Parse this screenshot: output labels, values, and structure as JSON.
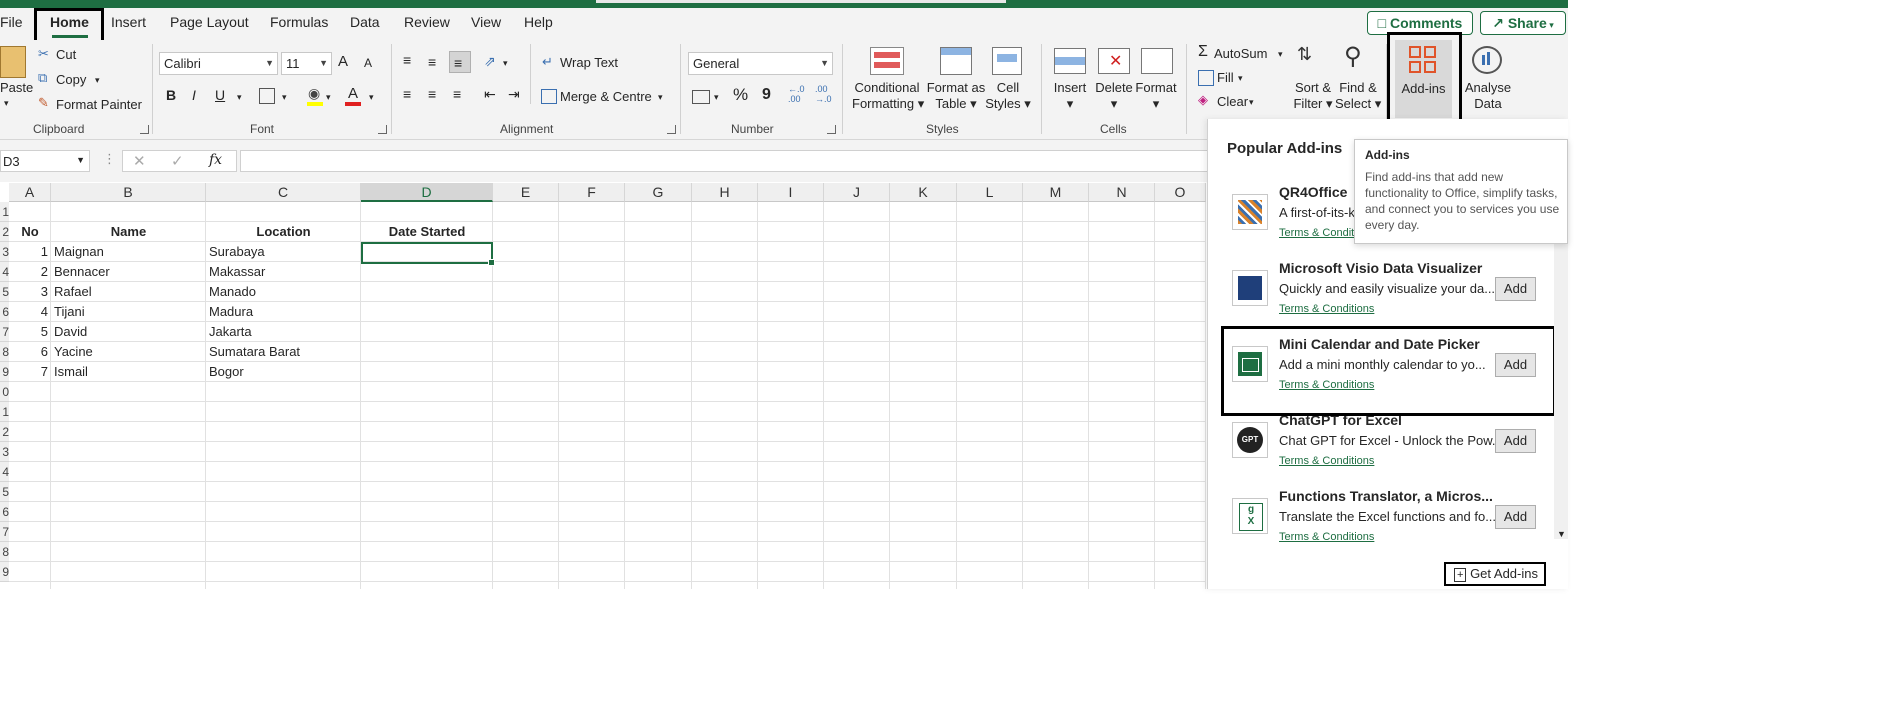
{
  "tabs": [
    "File",
    "Home",
    "Insert",
    "Page Layout",
    "Formulas",
    "Data",
    "Review",
    "View",
    "Help"
  ],
  "header": {
    "comments": "Comments",
    "share": "Share"
  },
  "clipboard": {
    "paste": "Paste",
    "cut": "Cut",
    "copy": "Copy",
    "format_painter": "Format Painter",
    "label": "Clipboard"
  },
  "font": {
    "name": "Calibri",
    "size": "11",
    "bold": "B",
    "italic": "I",
    "underline": "U",
    "color_letter": "A",
    "grow": "A",
    "shrink": "A",
    "label": "Font"
  },
  "alignment": {
    "wrap_text": "Wrap Text",
    "merge_centre": "Merge & Centre",
    "label": "Alignment"
  },
  "number": {
    "format": "General",
    "percent": "%",
    "comma": "9",
    "inc_dec1": ".0",
    "inc_dec2": ".00",
    "dec_dec1": ".00",
    "dec_dec2": ".0",
    "label": "Number"
  },
  "styles": {
    "conditional": [
      "Conditional",
      "Formatting"
    ],
    "format_table": [
      "Format as",
      "Table"
    ],
    "cell_styles": [
      "Cell",
      "Styles"
    ],
    "label": "Styles"
  },
  "cells": {
    "insert": "Insert",
    "delete": "Delete",
    "format": "Format",
    "label": "Cells"
  },
  "editing": {
    "autosum": "AutoSum",
    "fill": "Fill",
    "clear": "Clear",
    "sort_filter": [
      "Sort &",
      "Filter"
    ],
    "find_select": [
      "Find &",
      "Select"
    ]
  },
  "addins_btn": "Add-ins",
  "analyse_btn": [
    "Analyse",
    "Data"
  ],
  "formula_bar": {
    "name_box": "D3",
    "fx": "fx"
  },
  "sheet": {
    "columns": [
      "A",
      "B",
      "C",
      "D",
      "E",
      "F",
      "G",
      "H",
      "I",
      "J",
      "K",
      "L",
      "M",
      "N",
      "O"
    ],
    "row_numbers": [
      "1",
      "2",
      "3",
      "4",
      "5",
      "6",
      "7",
      "8",
      "9",
      "0",
      "1",
      "2",
      "3",
      "4",
      "5",
      "6",
      "7",
      "8",
      "9"
    ],
    "header": {
      "no": "No",
      "name": "Name",
      "location": "Location",
      "date_started": "Date Started"
    },
    "rows": [
      {
        "no": "1",
        "name": "Maignan",
        "location": "Surabaya"
      },
      {
        "no": "2",
        "name": "Bennacer",
        "location": "Makassar"
      },
      {
        "no": "3",
        "name": "Rafael",
        "location": "Manado"
      },
      {
        "no": "4",
        "name": "Tijani",
        "location": "Madura"
      },
      {
        "no": "5",
        "name": "David",
        "location": "Jakarta"
      },
      {
        "no": "6",
        "name": "Yacine",
        "location": "Sumatara Barat"
      },
      {
        "no": "7",
        "name": "Ismail",
        "location": "Bogor"
      }
    ]
  },
  "addins_pane": {
    "title": "Popular Add-ins",
    "items": [
      {
        "name": "QR4Office",
        "desc": "A first-of-its-k",
        "terms": "Terms & Conditions",
        "icon": "qr-icon"
      },
      {
        "name": "Microsoft Visio Data Visualizer",
        "desc": "Quickly and easily visualize your da...",
        "terms": "Terms & Conditions",
        "add": "Add",
        "icon": "visio-icon"
      },
      {
        "name": "Mini Calendar and Date Picker",
        "desc": "Add a mini monthly calendar to yo...",
        "terms": "Terms & Conditions",
        "add": "Add",
        "icon": "calendar-icon"
      },
      {
        "name": "ChatGPT for Excel",
        "desc": "Chat GPT for Excel - Unlock the Pow...",
        "terms": "Terms & Conditions",
        "add": "Add",
        "icon_text": "GPT",
        "icon": "gpt-icon"
      },
      {
        "name": "Functions Translator, a Micros...",
        "desc": "Translate the Excel functions and fo...",
        "terms": "Terms & Conditions",
        "add": "Add",
        "icon": "translator-icon"
      }
    ],
    "get_addins": "Get Add-ins"
  },
  "tooltip": {
    "title": "Add-ins",
    "body": "Find add-ins that add new functionality to Office, simplify tasks, and connect you to services you use every day."
  },
  "colors": {
    "accent": "#1e6e42",
    "highlight": "#000000"
  }
}
